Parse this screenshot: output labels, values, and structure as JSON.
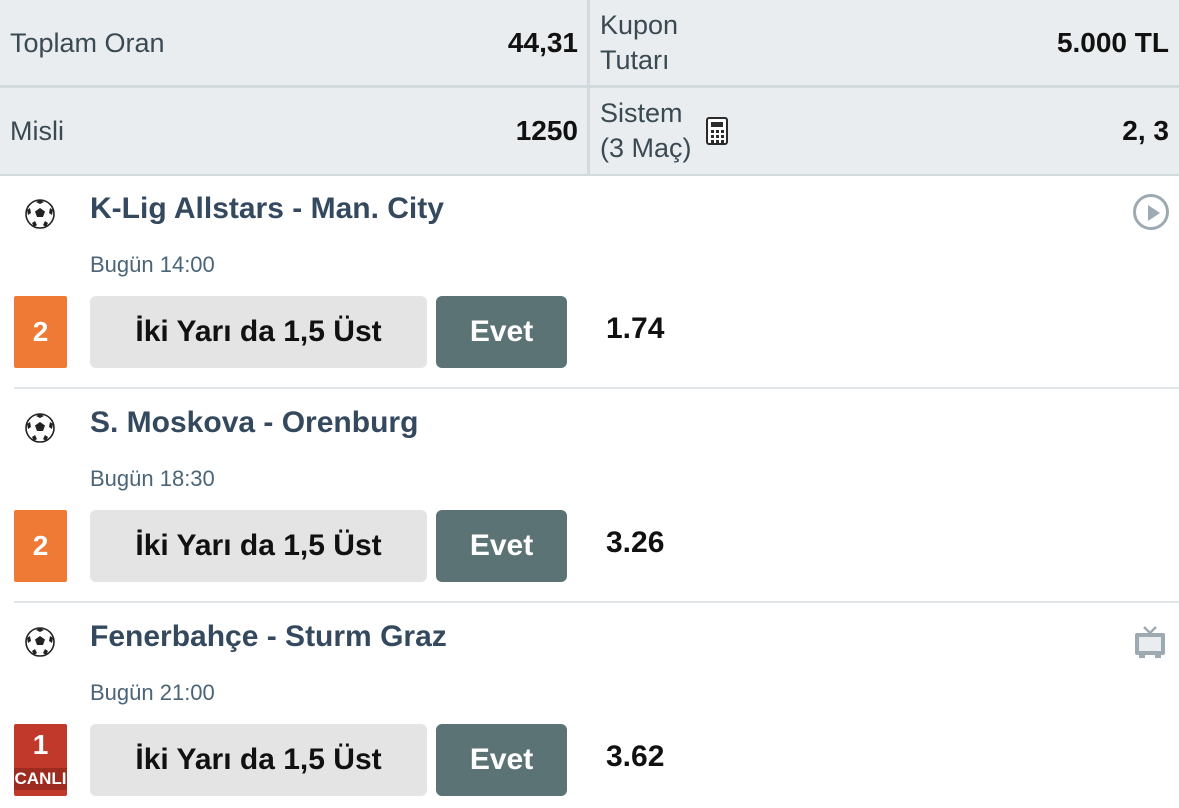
{
  "summary": {
    "total_odds_label": "Toplam Oran",
    "total_odds_value": "44,31",
    "coupon_amount_label_line1": "Kupon",
    "coupon_amount_label_line2": "Tutarı",
    "coupon_amount_value": "5.000 TL",
    "multiplier_label": "Misli",
    "multiplier_value": "1250",
    "system_label_line1": "Sistem",
    "system_label_line2": "(3 Maç)",
    "system_value": "2, 3"
  },
  "matches": [
    {
      "teams": "K-Lig Allstars - Man. City",
      "time": "Bugün 14:00",
      "mbs": "2",
      "market": "İki Yarı da 1,5 Üst",
      "outcome": "Evet",
      "odd": "1.74",
      "icon": "play-icon"
    },
    {
      "teams": "S. Moskova - Orenburg",
      "time": "Bugün 18:30",
      "mbs": "2",
      "market": "İki Yarı da 1,5 Üst",
      "outcome": "Evet",
      "odd": "3.26"
    },
    {
      "teams": "Fenerbahçe - Sturm Graz",
      "time": "Bugün 21:00",
      "mbs": "1",
      "live_label": "CANLI",
      "market": "İki Yarı da 1,5 Üst",
      "outcome": "Evet",
      "odd": "3.62",
      "icon": "tv-icon"
    }
  ],
  "colors": {
    "mbs_orange": "#ee7a35",
    "mbs_live_red": "#c0392b",
    "outcome_button": "#5c7376",
    "team_text": "#34495e"
  }
}
